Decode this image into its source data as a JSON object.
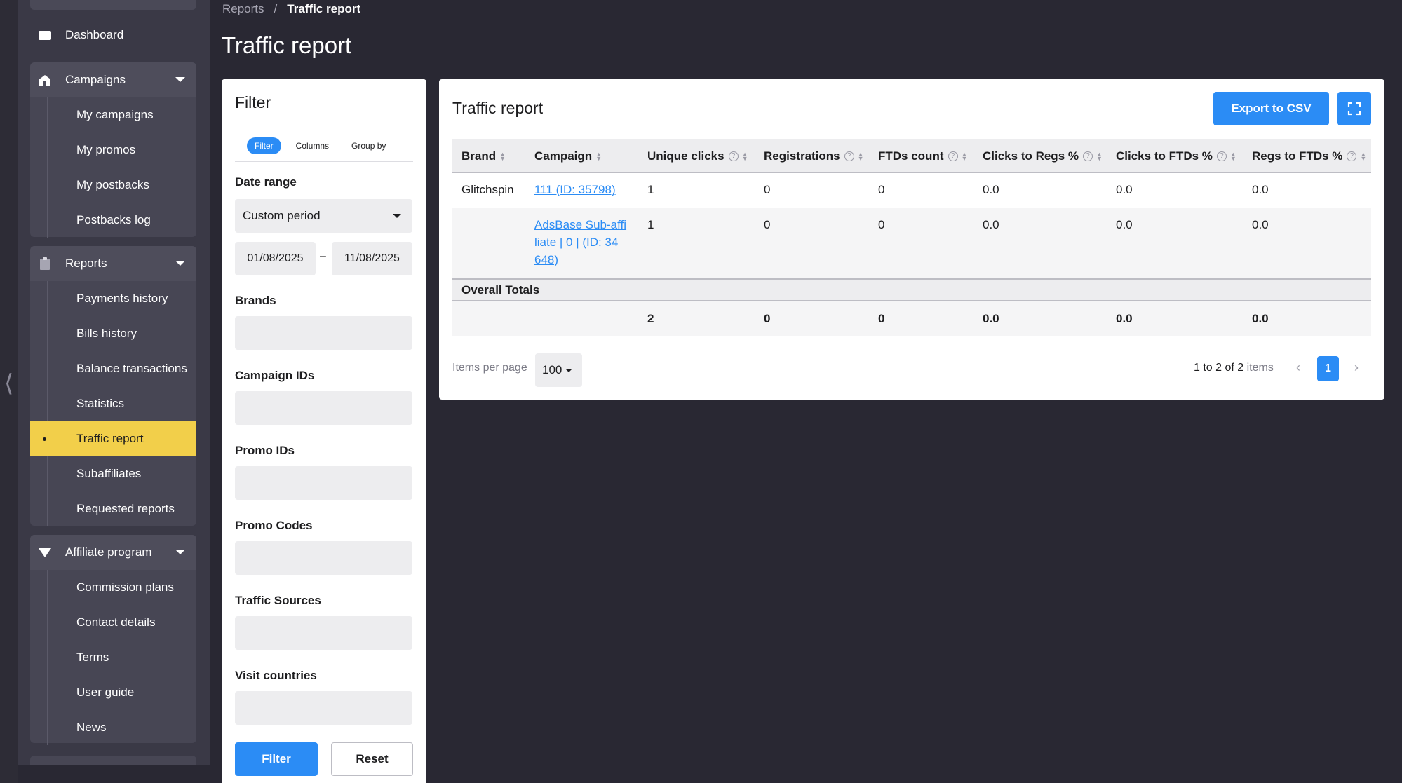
{
  "sidebar": {
    "dashboard": "Dashboard",
    "campaigns": {
      "label": "Campaigns",
      "items": [
        "My campaigns",
        "My promos",
        "My postbacks",
        "Postbacks log"
      ]
    },
    "reports": {
      "label": "Reports",
      "items": [
        "Payments history",
        "Bills history",
        "Balance transactions",
        "Statistics",
        "Traffic report",
        "Subaffiliates",
        "Requested reports"
      ]
    },
    "affiliate": {
      "label": "Affiliate program",
      "items": [
        "Commission plans",
        "Contact details",
        "Terms",
        "User guide",
        "News"
      ]
    },
    "active_item": "Traffic report",
    "active_color": "#f2cf4a"
  },
  "header": {
    "breadcrumb_parent": "Reports",
    "breadcrumb_sep": "/",
    "breadcrumb_current": "Traffic report",
    "title": "Traffic report"
  },
  "filter": {
    "title": "Filter",
    "tabs": [
      "Filter",
      "Columns",
      "Group by"
    ],
    "date_range_label": "Date range",
    "period": "Custom period",
    "date_from": "01/08/2025",
    "date_sep": "–",
    "date_to": "11/08/2025",
    "brands_label": "Brands",
    "campaign_ids_label": "Campaign IDs",
    "promo_ids_label": "Promo IDs",
    "promo_codes_label": "Promo Codes",
    "traffic_sources_label": "Traffic Sources",
    "visit_countries_label": "Visit countries",
    "filter_button": "Filter",
    "reset_button": "Reset"
  },
  "report": {
    "title": "Traffic report",
    "export_button": "Export to CSV",
    "columns": [
      "Brand",
      "Campaign",
      "Unique clicks",
      "Registrations",
      "FTDs count",
      "Clicks to Regs %",
      "Clicks to FTDs %",
      "Regs to FTDs %"
    ],
    "rows": [
      {
        "brand": "Glitchspin",
        "campaign": "111 (ID: 35798)",
        "unique_clicks": "1",
        "registrations": "0",
        "ftds": "0",
        "c2r": "0.0",
        "c2f": "0.0",
        "r2f": "0.0"
      },
      {
        "brand": "",
        "campaign_lines": [
          "AdsBase Sub-affi",
          "liate | 0 | (ID: 34",
          "648)"
        ],
        "unique_clicks": "1",
        "registrations": "0",
        "ftds": "0",
        "c2r": "0.0",
        "c2f": "0.0",
        "r2f": "0.0"
      }
    ],
    "totals_label": "Overall Totals",
    "totals": {
      "unique_clicks": "2",
      "registrations": "0",
      "ftds": "0",
      "c2r": "0.0",
      "c2f": "0.0",
      "r2f": "0.0"
    },
    "items_per_page_label": "Items per page",
    "items_per_page": "100",
    "pager_range": "1 to 2 of 2",
    "pager_items": "items",
    "current_page": "1"
  },
  "colors": {
    "accent": "#2b8cf5",
    "background": "#292833",
    "sidebar": "#3a3946"
  }
}
